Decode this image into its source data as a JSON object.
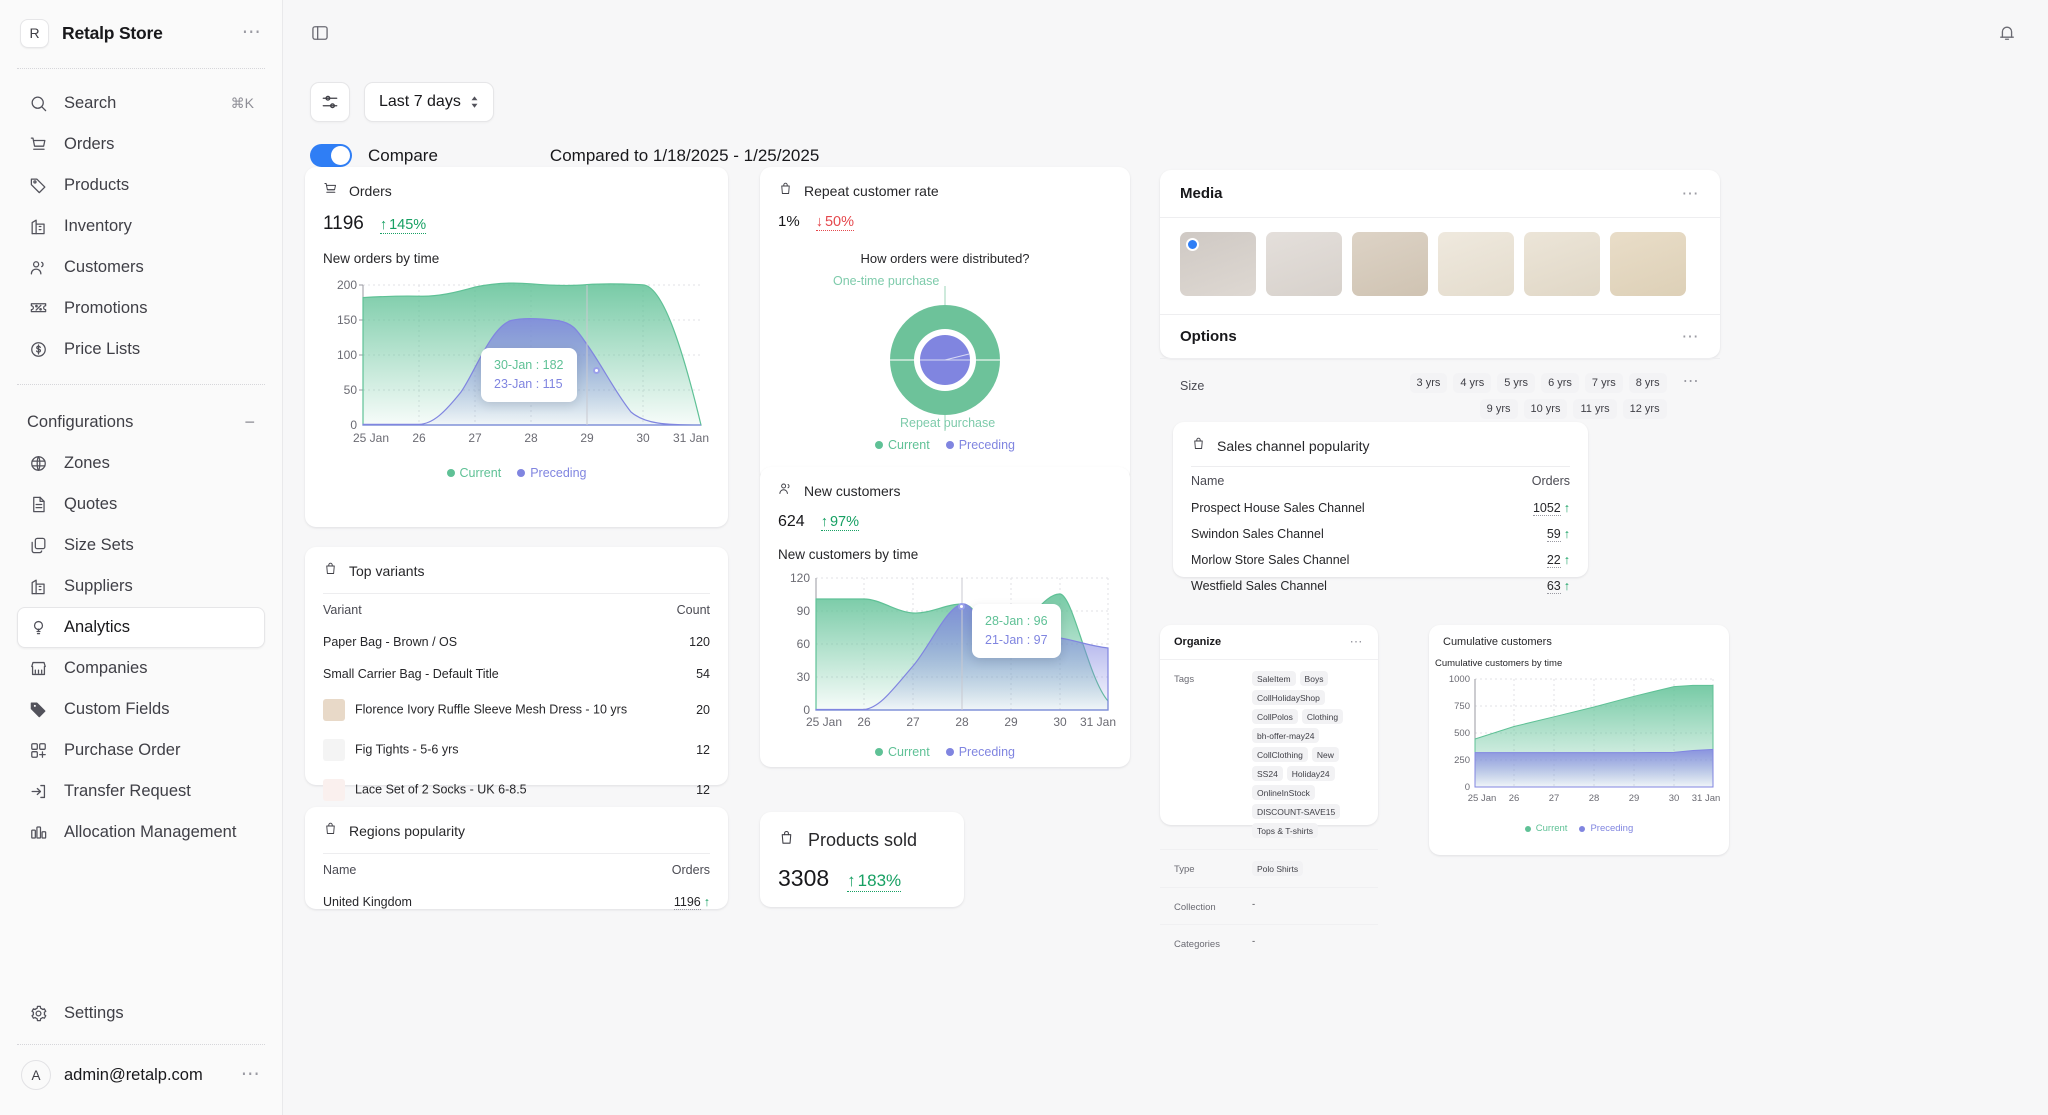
{
  "sidebar": {
    "brand": {
      "badge": "R",
      "name": "Retalp Store",
      "menu": "⋯"
    },
    "items": [
      {
        "label": "Search",
        "icon": "search-icon",
        "shortcut": "⌘K"
      },
      {
        "label": "Orders",
        "icon": "cart-icon"
      },
      {
        "label": "Products",
        "icon": "tag-icon"
      },
      {
        "label": "Inventory",
        "icon": "building-icon"
      },
      {
        "label": "Customers",
        "icon": "users-icon"
      },
      {
        "label": "Promotions",
        "icon": "ticket-percent-icon"
      },
      {
        "label": "Price Lists",
        "icon": "dollar-circle-icon"
      }
    ],
    "section": {
      "label": "Configurations",
      "collapse": "−"
    },
    "config_items": [
      {
        "label": "Zones",
        "icon": "globe-icon"
      },
      {
        "label": "Quotes",
        "icon": "document-icon"
      },
      {
        "label": "Size Sets",
        "icon": "copy-icon"
      },
      {
        "label": "Suppliers",
        "icon": "building-icon"
      },
      {
        "label": "Analytics",
        "icon": "bulb-icon",
        "active": true
      },
      {
        "label": "Companies",
        "icon": "store-icon"
      },
      {
        "label": "Custom Fields",
        "icon": "tag-filled-icon"
      },
      {
        "label": "Purchase Order",
        "icon": "grid-plus-icon"
      },
      {
        "label": "Transfer Request",
        "icon": "arrow-in-box-icon"
      },
      {
        "label": "Allocation Management",
        "icon": "bar-chart-icon"
      }
    ],
    "settings": {
      "label": "Settings",
      "icon": "gear-icon"
    },
    "user": {
      "avatar": "A",
      "email": "admin@retalp.com",
      "menu": "⋯"
    }
  },
  "topbar": {
    "sidebar_toggle": "panel-toggle-icon",
    "notifications": "bell-icon"
  },
  "toolbar": {
    "filter_icon": "sliders-icon",
    "range_label": "Last 7 days",
    "compare_label": "Compare",
    "compare_on": true,
    "compared_to": "Compared to 1/18/2025 - 1/25/2025"
  },
  "cards": {
    "orders": {
      "title": "Orders",
      "icon": "cart-icon",
      "value": "1196",
      "delta": "145%",
      "delta_dir": "up",
      "chart_caption": "New orders by time",
      "tooltip": {
        "current": "30-Jan : 182",
        "preceding": "23-Jan : 115"
      },
      "legend": {
        "current": "Current",
        "preceding": "Preceding"
      }
    },
    "repeat_customer_rate": {
      "title": "Repeat customer rate",
      "icon": "bag-icon",
      "value": "1%",
      "delta": "50%",
      "delta_dir": "down",
      "chart_caption": "How orders were distributed?",
      "label_outer": "One-time purchase",
      "label_inner": "Repeat purchase",
      "legend": {
        "current": "Current",
        "preceding": "Preceding"
      }
    },
    "new_customers": {
      "title": "New customers",
      "icon": "customers-icon",
      "value": "624",
      "delta": "97%",
      "delta_dir": "up",
      "chart_caption": "New customers by time",
      "tooltip": {
        "current": "28-Jan : 96",
        "preceding": "21-Jan : 97"
      },
      "legend": {
        "current": "Current",
        "preceding": "Preceding"
      }
    },
    "top_variants": {
      "title": "Top variants",
      "icon": "bag-icon",
      "columns": [
        "Variant",
        "Count"
      ],
      "rows": [
        {
          "name": "Paper Bag - Brown / OS",
          "count": "120",
          "thumb": null
        },
        {
          "name": "Small Carrier Bag - Default Title",
          "count": "54",
          "thumb": null
        },
        {
          "name": "Florence Ivory Ruffle Sleeve Mesh Dress - 10 yrs",
          "count": "20",
          "thumb": "#e8d9c8"
        },
        {
          "name": "Fig Tights - 5-6 yrs",
          "count": "12",
          "thumb": "#f4f4f4"
        },
        {
          "name": "Lace Set of 2 Socks - UK 6-8.5",
          "count": "12",
          "thumb": "#faf0ee"
        }
      ]
    },
    "regions_popularity": {
      "title": "Regions popularity",
      "icon": "bag-icon",
      "columns": [
        "Name",
        "Orders"
      ],
      "rows": [
        {
          "name": "United Kingdom",
          "orders": "1196"
        }
      ]
    },
    "products_sold": {
      "title": "Products sold",
      "icon": "bag-icon",
      "value": "3308",
      "delta": "183%",
      "delta_dir": "up"
    },
    "sales_channel_popularity": {
      "title": "Sales channel popularity",
      "icon": "bag-icon",
      "columns": [
        "Name",
        "Orders"
      ],
      "rows": [
        {
          "name": "Prospect House Sales Channel",
          "orders": "1052"
        },
        {
          "name": "Swindon Sales Channel",
          "orders": "59"
        },
        {
          "name": "Morlow Store Sales Channel",
          "orders": "22"
        },
        {
          "name": "Westfield Sales Channel",
          "orders": "63"
        }
      ]
    },
    "cumulative_customers": {
      "title": "Cumulative customers",
      "chart_caption": "Cumulative customers by time",
      "legend": {
        "current": "Current",
        "preceding": "Preceding"
      }
    }
  },
  "media_panel": {
    "title": "Media",
    "menu": "⋯",
    "thumbs": [
      {
        "bg": "#d9d4d0",
        "selected": true
      },
      {
        "bg": "#e2ddd9",
        "selected": false
      },
      {
        "bg": "#ddd4c9",
        "selected": false
      },
      {
        "bg": "#ece5da",
        "selected": false
      },
      {
        "bg": "#eae3d8",
        "selected": false
      },
      {
        "bg": "#e7dcca",
        "selected": false
      }
    ]
  },
  "options_panel": {
    "title": "Options",
    "menu": "⋯",
    "row_label": "Size",
    "row_menu": "⋯",
    "values": [
      "3 yrs",
      "4 yrs",
      "5 yrs",
      "6 yrs",
      "7 yrs",
      "8 yrs",
      "9 yrs",
      "10 yrs",
      "11 yrs",
      "12 yrs"
    ]
  },
  "organize_panel": {
    "title": "Organize",
    "menu": "⋯",
    "rows": [
      {
        "key": "Tags",
        "pills": [
          "SaleItem",
          "Boys",
          "CollHolidayShop",
          "CollPolos",
          "Clothing",
          "bh-offer-may24",
          "CollClothing",
          "New",
          "SS24",
          "Holiday24",
          "OnlineInStock",
          "DISCOUNT-SAVE15",
          "Tops & T-shirts"
        ]
      },
      {
        "key": "Type",
        "pills": [
          "Polo Shirts"
        ]
      },
      {
        "key": "Collection",
        "text": "-"
      },
      {
        "key": "Categories",
        "text": "-"
      }
    ]
  },
  "colors": {
    "current": "#5fc196",
    "preceding": "#8085e0",
    "accent": "#2f7ef5",
    "positive": "#17a063",
    "negative": "#e5484d"
  },
  "chart_data": [
    {
      "id": "orders-area",
      "type": "area",
      "title": "New orders by time",
      "x": [
        "25 Jan",
        "26",
        "27",
        "28",
        "29",
        "30",
        "31 Jan"
      ],
      "ylim": [
        0,
        200
      ],
      "yticks": [
        0,
        50,
        100,
        150,
        200
      ],
      "grid": true,
      "legend_position": "bottom",
      "series": [
        {
          "name": "Current",
          "color": "#5fc196",
          "values": [
            182,
            184,
            190,
            197,
            194,
            196,
            0
          ]
        },
        {
          "name": "Preceding",
          "color": "#8085e0",
          "values": [
            0,
            1,
            48,
            136,
            146,
            115,
            0
          ]
        }
      ],
      "highlight": {
        "x": "30",
        "current": 182,
        "preceding": 115
      }
    },
    {
      "id": "repeat-customer-donut",
      "type": "pie",
      "title": "How orders were distributed?",
      "labels": [
        "One-time purchase",
        "Repeat purchase"
      ],
      "series": [
        {
          "name": "Current",
          "color": "#5fc196",
          "values": [
            99,
            1
          ]
        },
        {
          "name": "Preceding",
          "color": "#8085e0",
          "values": [
            98,
            2
          ]
        }
      ]
    },
    {
      "id": "new-customers-area",
      "type": "area",
      "title": "New customers by time",
      "x": [
        "25 Jan",
        "26",
        "27",
        "28",
        "29",
        "30",
        "31 Jan"
      ],
      "ylim": [
        0,
        120
      ],
      "yticks": [
        0,
        30,
        60,
        90,
        120
      ],
      "grid": true,
      "legend_position": "bottom",
      "series": [
        {
          "name": "Current",
          "color": "#5fc196",
          "values": [
            101,
            101,
            88,
            96,
            71,
            105,
            8
          ]
        },
        {
          "name": "Preceding",
          "color": "#8085e0",
          "values": [
            0,
            0,
            40,
            97,
            59,
            65,
            57
          ]
        }
      ],
      "highlight": {
        "x": "28",
        "current": 96,
        "preceding": 97
      }
    },
    {
      "id": "cumulative-customers-area",
      "type": "area",
      "title": "Cumulative customers by time",
      "x": [
        "25 Jan",
        "26",
        "27",
        "28",
        "29",
        "30",
        "31 Jan"
      ],
      "ylim": [
        0,
        1000
      ],
      "yticks": [
        0,
        250,
        500,
        750,
        1000
      ],
      "grid": true,
      "legend_position": "bottom",
      "series": [
        {
          "name": "Current",
          "color": "#5fc196",
          "values": [
            447,
            560,
            650,
            740,
            840,
            930,
            940
          ]
        },
        {
          "name": "Preceding",
          "color": "#8085e0",
          "values": [
            318,
            318,
            318,
            318,
            318,
            320,
            348
          ]
        }
      ]
    }
  ]
}
